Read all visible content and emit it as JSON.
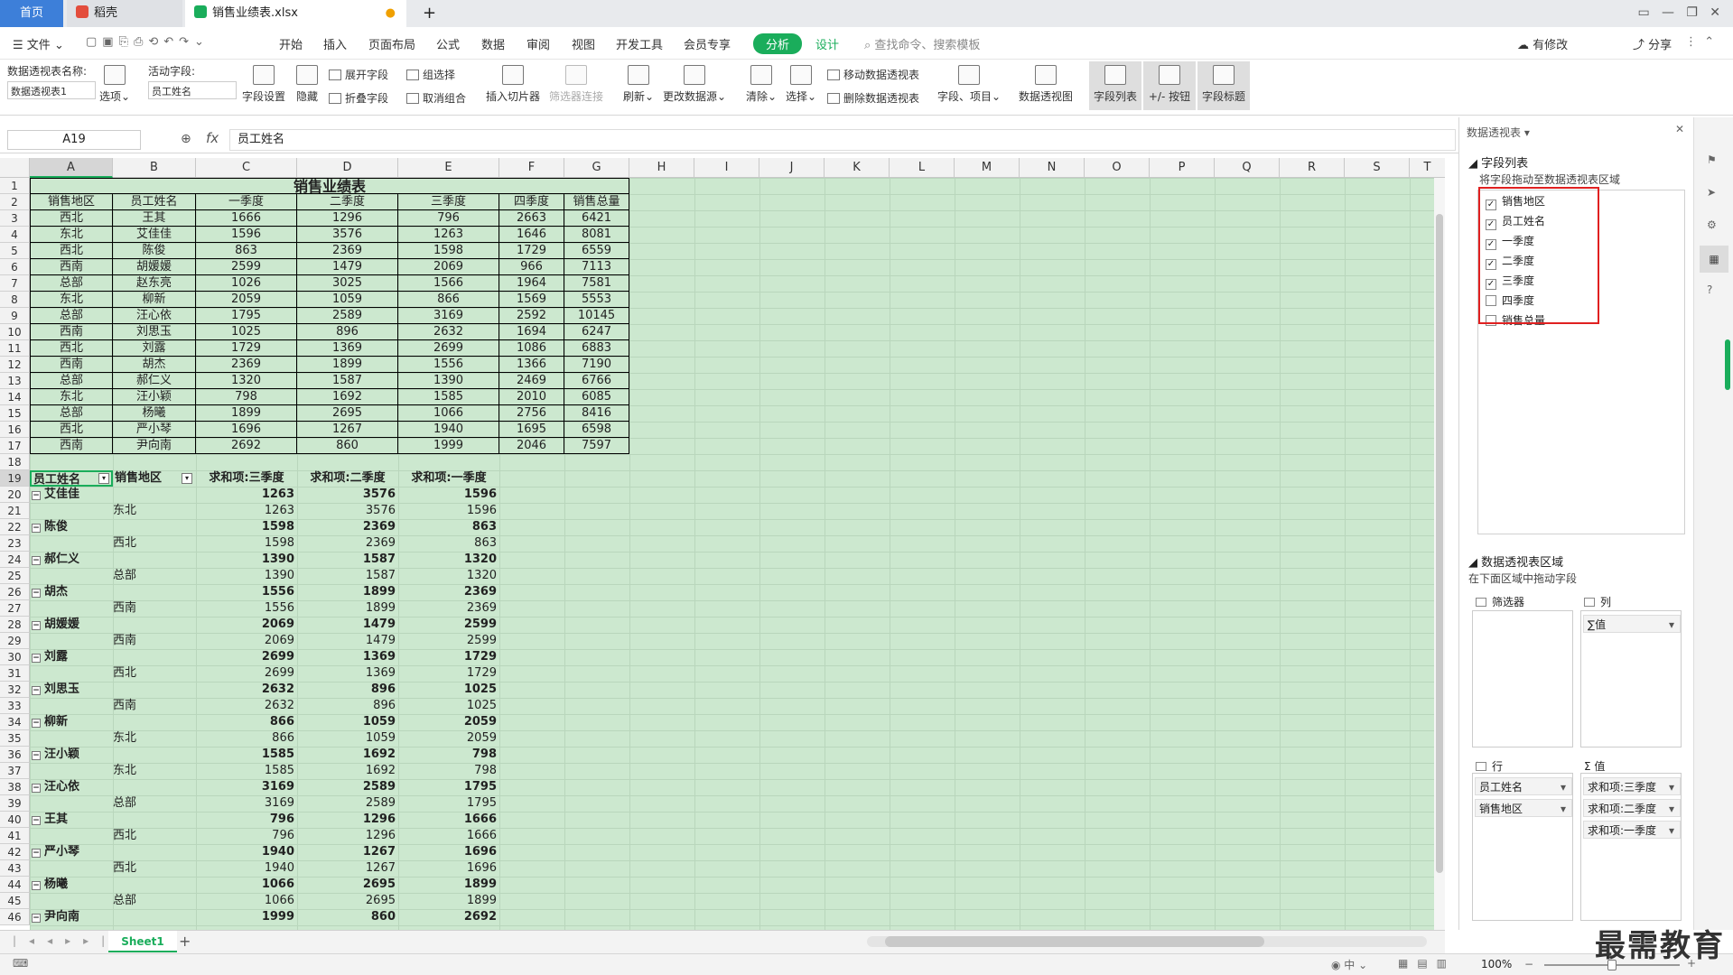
{
  "tabs": {
    "home": "首页",
    "daoke": "稻壳",
    "file": "销售业绩表.xlsx",
    "add": "+"
  },
  "menu": {
    "file": "文件",
    "items": [
      "开始",
      "插入",
      "页面布局",
      "公式",
      "数据",
      "审阅",
      "视图",
      "开发工具",
      "会员专享"
    ],
    "analyze": "分析",
    "design": "设计",
    "search": "查找命令、搜索模板",
    "share": "分享",
    "sync": "有修改"
  },
  "ribbon": {
    "pt_name_label": "数据透视表名称:",
    "pt_name_value": "数据透视表1",
    "options": "选项",
    "active_field_label": "活动字段:",
    "active_field_value": "员工姓名",
    "field_settings": "字段设置",
    "hide": "隐藏",
    "expand": "展开字段",
    "collapse": "折叠字段",
    "group_sel": "组选择",
    "ungroup": "取消组合",
    "insert_slicer": "插入切片器",
    "filter_conn": "筛选器连接",
    "refresh": "刷新",
    "change_source": "更改数据源",
    "clear": "清除",
    "select": "选择",
    "move_pt": "移动数据透视表",
    "delete_pt": "删除数据透视表",
    "fields_items": "字段、项目",
    "pt_view": "数据透视图",
    "field_list": "字段列表",
    "plus_minus": "+/- 按钮",
    "field_header": "字段标题"
  },
  "formula": {
    "cellref": "A19",
    "fx": "fx",
    "value": "员工姓名"
  },
  "columns": [
    "A",
    "B",
    "C",
    "D",
    "E",
    "F",
    "G",
    "H",
    "I",
    "J",
    "K",
    "L",
    "M",
    "N",
    "O",
    "P",
    "Q",
    "R",
    "S",
    "T"
  ],
  "rows": [
    "1",
    "2",
    "3",
    "4",
    "5",
    "6",
    "7",
    "8",
    "9",
    "10",
    "11",
    "12",
    "13",
    "14",
    "15",
    "16",
    "17",
    "18",
    "19",
    "20",
    "21",
    "22",
    "23",
    "24",
    "25",
    "26",
    "27",
    "28",
    "29",
    "30",
    "31",
    "32",
    "33",
    "34",
    "35",
    "36",
    "37",
    "38",
    "39",
    "40",
    "41",
    "42",
    "43",
    "44",
    "45",
    "46"
  ],
  "table": {
    "title": "销售业绩表",
    "headers": [
      "销售地区",
      "员工姓名",
      "一季度",
      "二季度",
      "三季度",
      "四季度",
      "销售总量"
    ],
    "data": [
      [
        "西北",
        "王其",
        "1666",
        "1296",
        "796",
        "2663",
        "6421"
      ],
      [
        "东北",
        "艾佳佳",
        "1596",
        "3576",
        "1263",
        "1646",
        "8081"
      ],
      [
        "西北",
        "陈俊",
        "863",
        "2369",
        "1598",
        "1729",
        "6559"
      ],
      [
        "西南",
        "胡媛媛",
        "2599",
        "1479",
        "2069",
        "966",
        "7113"
      ],
      [
        "总部",
        "赵东亮",
        "1026",
        "3025",
        "1566",
        "1964",
        "7581"
      ],
      [
        "东北",
        "柳新",
        "2059",
        "1059",
        "866",
        "1569",
        "5553"
      ],
      [
        "总部",
        "汪心依",
        "1795",
        "2589",
        "3169",
        "2592",
        "10145"
      ],
      [
        "西南",
        "刘思玉",
        "1025",
        "896",
        "2632",
        "1694",
        "6247"
      ],
      [
        "西北",
        "刘露",
        "1729",
        "1369",
        "2699",
        "1086",
        "6883"
      ],
      [
        "西南",
        "胡杰",
        "2369",
        "1899",
        "1556",
        "1366",
        "7190"
      ],
      [
        "总部",
        "郝仁义",
        "1320",
        "1587",
        "1390",
        "2469",
        "6766"
      ],
      [
        "东北",
        "汪小颖",
        "798",
        "1692",
        "1585",
        "2010",
        "6085"
      ],
      [
        "总部",
        "杨曦",
        "1899",
        "2695",
        "1066",
        "2756",
        "8416"
      ],
      [
        "西北",
        "严小琴",
        "1696",
        "1267",
        "1940",
        "1695",
        "6598"
      ],
      [
        "西南",
        "尹向南",
        "2692",
        "860",
        "1999",
        "2046",
        "7597"
      ]
    ]
  },
  "pivot": {
    "headers": [
      "员工姓名",
      "销售地区",
      "求和项:三季度",
      "求和项:二季度",
      "求和项:一季度"
    ],
    "groups": [
      {
        "name": "艾佳佳",
        "region": "东北",
        "v": [
          "1263",
          "3576",
          "1596"
        ]
      },
      {
        "name": "陈俊",
        "region": "西北",
        "v": [
          "1598",
          "2369",
          "863"
        ]
      },
      {
        "name": "郝仁义",
        "region": "总部",
        "v": [
          "1390",
          "1587",
          "1320"
        ]
      },
      {
        "name": "胡杰",
        "region": "西南",
        "v": [
          "1556",
          "1899",
          "2369"
        ]
      },
      {
        "name": "胡媛媛",
        "region": "西南",
        "v": [
          "2069",
          "1479",
          "2599"
        ]
      },
      {
        "name": "刘露",
        "region": "西北",
        "v": [
          "2699",
          "1369",
          "1729"
        ]
      },
      {
        "name": "刘思玉",
        "region": "西南",
        "v": [
          "2632",
          "896",
          "1025"
        ]
      },
      {
        "name": "柳新",
        "region": "东北",
        "v": [
          "866",
          "1059",
          "2059"
        ]
      },
      {
        "name": "汪小颖",
        "region": "东北",
        "v": [
          "1585",
          "1692",
          "798"
        ]
      },
      {
        "name": "汪心依",
        "region": "总部",
        "v": [
          "3169",
          "2589",
          "1795"
        ]
      },
      {
        "name": "王其",
        "region": "西北",
        "v": [
          "796",
          "1296",
          "1666"
        ]
      },
      {
        "name": "严小琴",
        "region": "西北",
        "v": [
          "1940",
          "1267",
          "1696"
        ]
      },
      {
        "name": "杨曦",
        "region": "总部",
        "v": [
          "1066",
          "2695",
          "1899"
        ]
      },
      {
        "name": "尹向南",
        "region": "",
        "v": [
          "1999",
          "860",
          "2692"
        ]
      }
    ]
  },
  "sheet": {
    "name": "Sheet1",
    "add": "+"
  },
  "status": {
    "zoom": "100%"
  },
  "panel": {
    "title": "数据透视表",
    "field_list_title": "字段列表",
    "field_hint": "将字段拖动至数据透视表区域",
    "fields": [
      {
        "label": "销售地区",
        "checked": true
      },
      {
        "label": "员工姓名",
        "checked": true
      },
      {
        "label": "一季度",
        "checked": true
      },
      {
        "label": "二季度",
        "checked": true
      },
      {
        "label": "三季度",
        "checked": true
      },
      {
        "label": "四季度",
        "checked": false
      },
      {
        "label": "销售总量",
        "checked": false
      }
    ],
    "area_title": "数据透视表区域",
    "area_hint": "在下面区域中拖动字段",
    "filter": "筛选器",
    "columns": "列",
    "rows": "行",
    "values": "值",
    "col_items": [
      "∑值"
    ],
    "row_items": [
      "员工姓名",
      "销售地区"
    ],
    "val_items": [
      "求和项:三季度",
      "求和项:二季度",
      "求和项:一季度"
    ]
  },
  "watermark": "最需教育",
  "colors": {
    "accent": "#1aad5b",
    "highlight": "#e02020",
    "grid_bg": "#cce8cf"
  }
}
